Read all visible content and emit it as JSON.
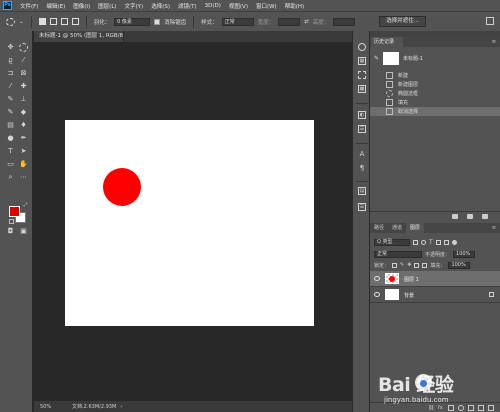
{
  "menubar": {
    "logo": "Ps",
    "items": [
      "文件(F)",
      "编辑(E)",
      "图像(I)",
      "图层(L)",
      "文字(Y)",
      "选择(S)",
      "滤镜(T)",
      "3D(D)",
      "视图(V)",
      "窗口(W)",
      "帮助(H)"
    ]
  },
  "options": {
    "feather_label": "羽化：",
    "feather_value": "0 像素",
    "antialias_label": "消除锯齿",
    "style_label": "样式：",
    "style_value": "正常",
    "width_label": "宽度：",
    "height_label": "高度：",
    "select_mask_label": "选择并遮住..."
  },
  "document": {
    "tab_title": "未标题-1 @ 50% (图层 1, RGB/8#) *",
    "canvas_color": "#ffffff",
    "circle_color": "#ff0000"
  },
  "status": {
    "zoom": "50%",
    "doc_info": "文档:2.63M/2.93M"
  },
  "colors": {
    "foreground": "#e00000",
    "background": "#ffffff"
  },
  "history": {
    "tab": "历史记录",
    "snapshot_label": "未标题-1",
    "items": [
      "新建",
      "新建图层",
      "椭圆选框",
      "填充",
      "取消选择"
    ],
    "active_index": 4
  },
  "layers_panel": {
    "tabs": [
      "路径",
      "通道",
      "图层"
    ],
    "active_tab": 2,
    "filter_label": "Q 类型",
    "blend_mode": "正常",
    "opacity_label": "不透明度：",
    "opacity_value": "100%",
    "lock_label": "锁定：",
    "fill_label": "填充：",
    "fill_value": "100%",
    "layers": [
      {
        "name": "图层 1",
        "selected": true
      },
      {
        "name": "背景",
        "selected": false
      }
    ]
  },
  "watermark": {
    "brand": "Bai  经验",
    "url": "jingyan.baidu.com"
  },
  "icons": [
    "move-icon",
    "marquee-icon",
    "lasso-icon",
    "magic-wand-icon",
    "crop-icon",
    "eyedropper-icon",
    "brush-icon",
    "stamp-icon",
    "eraser-icon",
    "gradient-icon",
    "pen-icon",
    "type-icon",
    "path-select-icon",
    "rectangle-icon",
    "hand-icon",
    "zoom-icon"
  ]
}
